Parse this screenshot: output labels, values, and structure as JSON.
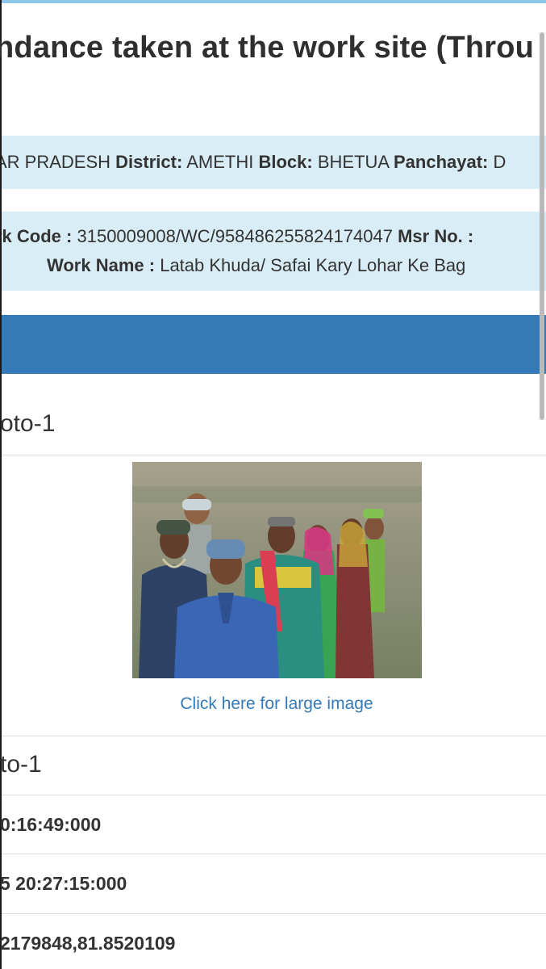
{
  "header": {
    "title": "ndance taken at the work site (Throu"
  },
  "location": {
    "state_value": "AR PRADESH",
    "district_label": "District:",
    "district_value": "AMETHI",
    "block_label": "Block:",
    "block_value": "BHETUA",
    "panchayat_label": "Panchayat:",
    "panchayat_value": "D"
  },
  "work": {
    "code_label": "rk Code :",
    "code_value": "3150009008/WC/958486255824174047",
    "msr_label": "Msr No. :",
    "name_label": "Work Name :",
    "name_value": "Latab Khuda/ Safai Kary Lohar Ke Bag"
  },
  "photo_section": {
    "title": "oto-1",
    "image_alt": "group photo of workers at site",
    "link_text": "Click here for large image"
  },
  "details": {
    "photo_label": "to-1",
    "time1": "0:16:49:000",
    "time2": "5 20:27:15:000",
    "coords": "2179848,81.8520109"
  },
  "colors": {
    "info_bg": "#d9edf7",
    "primary": "#337ab7"
  }
}
